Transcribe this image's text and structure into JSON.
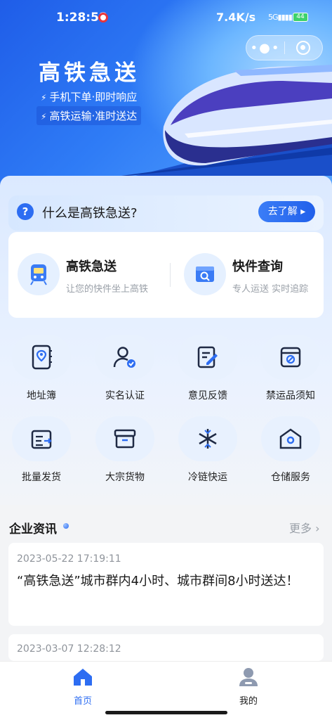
{
  "status_bar": {
    "time": "1:28:58",
    "network_speed": "7.4K/s",
    "signal": "5G",
    "battery": "44"
  },
  "capsule": {
    "more_icon": "more-dots-icon",
    "close_icon": "target-close-icon"
  },
  "hero": {
    "title": "高铁急送",
    "subtitle1": "手机下单·即时响应",
    "subtitle2": "高铁运输·准时送达"
  },
  "banner": {
    "text": "什么是高铁急送?",
    "button": "去了解"
  },
  "services": [
    {
      "title": "高铁急送",
      "desc": "让您的快件坐上高铁",
      "icon": "train-icon"
    },
    {
      "title": "快件查询",
      "desc": "专人运送 实时追踪",
      "icon": "search-box-icon"
    }
  ],
  "grid": [
    {
      "label": "地址簿",
      "icon": "address-book-icon"
    },
    {
      "label": "实名认证",
      "icon": "verified-user-icon"
    },
    {
      "label": "意见反馈",
      "icon": "feedback-edit-icon"
    },
    {
      "label": "禁运品须知",
      "icon": "prohibited-box-icon"
    },
    {
      "label": "批量发货",
      "icon": "batch-ship-icon"
    },
    {
      "label": "大宗货物",
      "icon": "bulk-cargo-icon"
    },
    {
      "label": "冷链快运",
      "icon": "snowflake-icon"
    },
    {
      "label": "仓储服务",
      "icon": "warehouse-icon"
    }
  ],
  "news": {
    "title": "企业资讯",
    "more": "更多",
    "items": [
      {
        "date": "2023-05-22 17:19:11",
        "text": "“高铁急送”城市群内4小时、城市群间8小时送达！"
      },
      {
        "date": "2023-03-07 12:28:12",
        "text": ""
      }
    ]
  },
  "tabbar": [
    {
      "label": "首页",
      "icon": "home-icon",
      "active": true
    },
    {
      "label": "我的",
      "icon": "user-icon",
      "active": false
    }
  ],
  "colors": {
    "primary": "#2d6df2",
    "accent_light": "#e8f1fe"
  }
}
